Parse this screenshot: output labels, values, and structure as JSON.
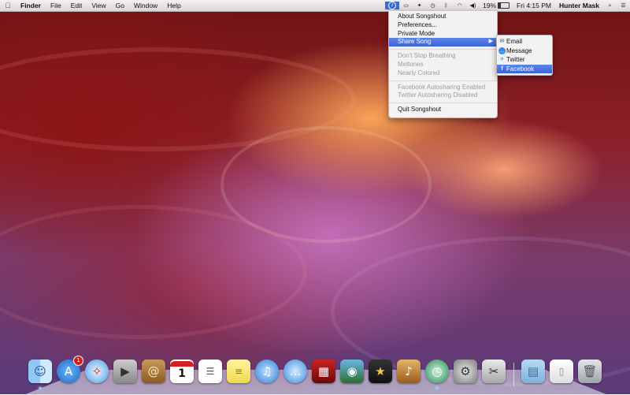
{
  "menubar": {
    "apple_icon": "apple-icon",
    "app_name": "Finder",
    "menus": [
      "File",
      "Edit",
      "View",
      "Go",
      "Window",
      "Help"
    ],
    "status_icons": [
      "songshout-icon",
      "airplay-icon",
      "dropbox-icon",
      "time-machine-icon",
      "bluetooth-icon",
      "wifi-icon",
      "volume-icon"
    ],
    "battery_percent": "19%",
    "battery_level": 0.19,
    "clock": "Fri 4:15 PM",
    "user": "Hunter Mask",
    "search_icon": "spotlight-icon",
    "notifications_icon": "notifications-icon"
  },
  "songshout_menu": {
    "items": [
      {
        "label": "About Songshout",
        "enabled": true
      },
      {
        "label": "Preferences...",
        "enabled": true
      },
      {
        "label": "Private Mode",
        "enabled": true
      },
      {
        "label": "Share Song",
        "enabled": true,
        "highlighted": true,
        "submenu": true
      }
    ],
    "recent_songs": [
      "Don't Stop Breathing",
      "Meltones",
      "Nearly Colored"
    ],
    "autosharing": [
      "Facebook Autosharing Enabled",
      "Twitter Autosharing Disabled"
    ],
    "quit": "Quit Songshout",
    "submenu_arrow": "▶"
  },
  "share_submenu": {
    "items": [
      {
        "label": "Email",
        "icon": "email-icon"
      },
      {
        "label": "Message",
        "icon": "message-icon"
      },
      {
        "label": "Twitter",
        "icon": "twitter-icon"
      },
      {
        "label": "Facebook",
        "icon": "facebook-icon",
        "highlighted": true
      }
    ]
  },
  "dock": {
    "app_store_badge": "1",
    "calendar_day": "1",
    "apps": [
      "Finder",
      "App Store",
      "Safari",
      "FaceTime",
      "Contacts",
      "Calendar",
      "Reminders",
      "Notes",
      "iTunes",
      "Messages",
      "Photo Booth",
      "iPhoto",
      "iMovie",
      "GarageBand",
      "Time Machine",
      "System Preferences",
      "Preview",
      "Applications",
      "Documents",
      "Trash"
    ]
  },
  "colors": {
    "highlight": "#3a63d8",
    "menu_bg": "#f6f6f6",
    "disabled_text": "#9c9c9c"
  }
}
